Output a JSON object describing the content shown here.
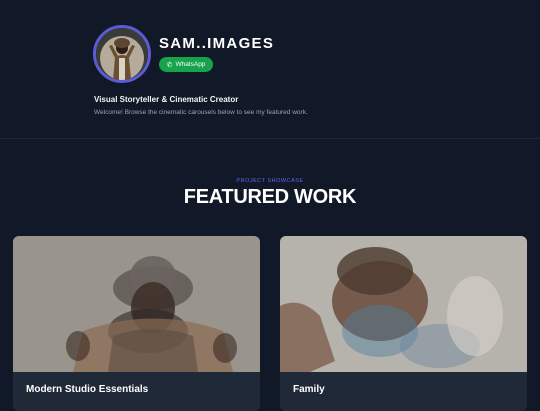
{
  "profile": {
    "name": "SAM..IMAGES",
    "whatsapp_label": "WhatsApp",
    "tagline": "Visual Storyteller & Cinematic Creator",
    "welcome": "Welcome! Browse the cinematic carousels below to see my featured work."
  },
  "section": {
    "eyebrow": "PROJECT SHOWCASE",
    "title": "FEATURED WORK"
  },
  "cards": [
    {
      "title": "Modern Studio Essentials"
    },
    {
      "title": "Family"
    }
  ],
  "colors": {
    "background": "#111827",
    "accent": "#6366f1",
    "whatsapp": "#16a34a",
    "card": "#1f2937"
  }
}
